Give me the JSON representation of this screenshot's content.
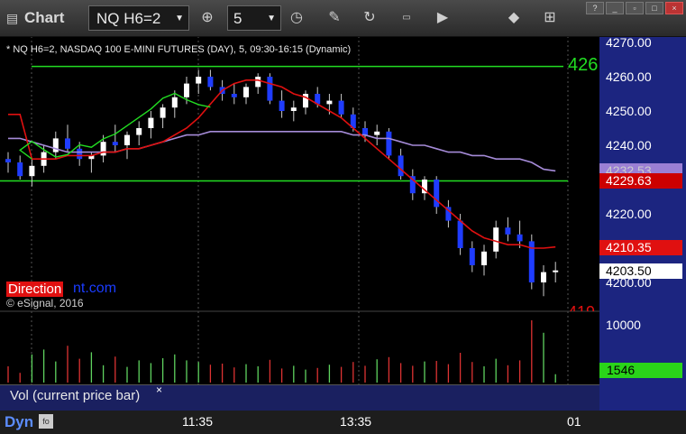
{
  "window": {
    "title": "Chart",
    "symbol_select": "NQ H6=2",
    "interval_select": "5"
  },
  "chart_header": "* NQ H6=2, NASDAQ 100 E-MINI FUTURES (DAY), 5, 09:30-16:15 (Dynamic)",
  "watermark": {
    "brand_a": "Direction",
    "brand_b": "nt.com",
    "copyright": "© eSignal, 2016"
  },
  "price_axis": {
    "ticks": [
      "4270.00",
      "4260.00",
      "4250.00",
      "4240.00",
      "4230.00",
      "4220.00",
      "4210.00",
      "4200.00"
    ]
  },
  "price_tags": [
    {
      "value": "4232.53",
      "color": "#9b7fd4",
      "text_color": "#cccccc"
    },
    {
      "value": "4229.63",
      "color": "#cc0000",
      "text_color": "#ffffff"
    },
    {
      "value": "4210.35",
      "color": "#e01010",
      "text_color": "#ffffff"
    },
    {
      "value": "4203.50",
      "color": "#ffffff",
      "text_color": "#000000"
    }
  ],
  "partial_labels": {
    "green_line": "426",
    "red_bottom": "419"
  },
  "volume": {
    "axis_label": "10000",
    "tag": "1546",
    "panel_label": "Vol (current price bar)",
    "close_glyph": "×"
  },
  "time_axis": {
    "ticks": [
      "11:35",
      "13:35",
      "01"
    ]
  },
  "bottom_bar": {
    "label": "Dyn"
  },
  "icons": [
    "menu-icon",
    "crosshair-icon",
    "clock-icon",
    "pencil-icon",
    "refresh-icon",
    "get-icon",
    "play-icon",
    "tag-icon",
    "grid-icon"
  ],
  "chart_data": {
    "type": "candlestick",
    "ylim": [
      4195,
      4271
    ],
    "levels": [
      {
        "name": "upper green",
        "value": 4263,
        "color": "#22dd22"
      },
      {
        "name": "lower green",
        "value": 4229.6,
        "color": "#22dd22"
      }
    ],
    "candles": [
      [
        4236,
        4238,
        4232,
        4235
      ],
      [
        4235,
        4237,
        4230,
        4231
      ],
      [
        4231,
        4236,
        4228,
        4234
      ],
      [
        4234,
        4240,
        4232,
        4238
      ],
      [
        4238,
        4244,
        4236,
        4242
      ],
      [
        4242,
        4246,
        4238,
        4239
      ],
      [
        4239,
        4241,
        4234,
        4236
      ],
      [
        4236,
        4238,
        4232,
        4237
      ],
      [
        4237,
        4243,
        4235,
        4241
      ],
      [
        4241,
        4246,
        4238,
        4240
      ],
      [
        4240,
        4244,
        4236,
        4243
      ],
      [
        4243,
        4247,
        4240,
        4245
      ],
      [
        4245,
        4250,
        4242,
        4248
      ],
      [
        4248,
        4252,
        4245,
        4251
      ],
      [
        4251,
        4256,
        4248,
        4254
      ],
      [
        4254,
        4260,
        4252,
        4258
      ],
      [
        4258,
        4262,
        4255,
        4260
      ],
      [
        4260,
        4262,
        4256,
        4257
      ],
      [
        4257,
        4259,
        4253,
        4255
      ],
      [
        4255,
        4258,
        4252,
        4254
      ],
      [
        4254,
        4258,
        4252,
        4257
      ],
      [
        4257,
        4261,
        4255,
        4260
      ],
      [
        4260,
        4261,
        4252,
        4253
      ],
      [
        4253,
        4256,
        4248,
        4250
      ],
      [
        4250,
        4253,
        4247,
        4251
      ],
      [
        4251,
        4256,
        4249,
        4255
      ],
      [
        4255,
        4257,
        4251,
        4252
      ],
      [
        4252,
        4255,
        4249,
        4253
      ],
      [
        4253,
        4255,
        4248,
        4249
      ],
      [
        4249,
        4251,
        4244,
        4245
      ],
      [
        4245,
        4247,
        4241,
        4243
      ],
      [
        4243,
        4246,
        4240,
        4244
      ],
      [
        4244,
        4245,
        4236,
        4237
      ],
      [
        4237,
        4239,
        4230,
        4231
      ],
      [
        4231,
        4233,
        4224,
        4226
      ],
      [
        4226,
        4231,
        4224,
        4230
      ],
      [
        4230,
        4231,
        4220,
        4222
      ],
      [
        4222,
        4224,
        4216,
        4218
      ],
      [
        4218,
        4220,
        4208,
        4210
      ],
      [
        4210,
        4212,
        4203,
        4205
      ],
      [
        4205,
        4211,
        4202,
        4209
      ],
      [
        4209,
        4218,
        4207,
        4216
      ],
      [
        4216,
        4219,
        4212,
        4214
      ],
      [
        4214,
        4218,
        4210,
        4212
      ],
      [
        4212,
        4214,
        4198,
        4200
      ],
      [
        4200,
        4205,
        4196,
        4203
      ],
      [
        4203,
        4206,
        4200,
        4203.5
      ]
    ],
    "ma_red": [
      4249,
      4249,
      4236,
      4236,
      4236,
      4237,
      4237,
      4237,
      4238,
      4238,
      4239,
      4239,
      4240,
      4241,
      4243,
      4245,
      4248,
      4252,
      4256,
      4258,
      4259,
      4259,
      4258,
      4257,
      4255,
      4254,
      4252,
      4250,
      4248,
      4245,
      4242,
      4239,
      4236,
      4233,
      4230,
      4227,
      4224,
      4221,
      4218,
      4215,
      4213,
      4212,
      4211,
      4211,
      4210,
      4210,
      4210.35
    ],
    "ma_purple": [
      4242,
      4242,
      4241,
      4240,
      4239,
      4238,
      4238,
      4238,
      4238,
      4238,
      4239,
      4239,
      4240,
      4241,
      4242,
      4243,
      4243,
      4244,
      4244,
      4244,
      4244,
      4244,
      4244,
      4244,
      4244,
      4244,
      4244,
      4244,
      4244,
      4243,
      4243,
      4242,
      4242,
      4241,
      4240,
      4240,
      4239,
      4238,
      4238,
      4237,
      4237,
      4236,
      4236,
      4236,
      4235,
      4233,
      4232.53
    ],
    "volume": [
      3000,
      1800,
      5200,
      6100,
      3900,
      6800,
      4400,
      5600,
      3200,
      4800,
      2900,
      4100,
      3600,
      4500,
      5200,
      4100,
      3800,
      3300,
      3500,
      2800,
      3400,
      3000,
      4200,
      2600,
      3100,
      2400,
      2700,
      3300,
      2900,
      3800,
      3100,
      4300,
      4700,
      3600,
      3100,
      3900,
      4000,
      3400,
      5500,
      3800,
      3000,
      4400,
      3200,
      4100,
      11500,
      9200,
      1546
    ]
  }
}
